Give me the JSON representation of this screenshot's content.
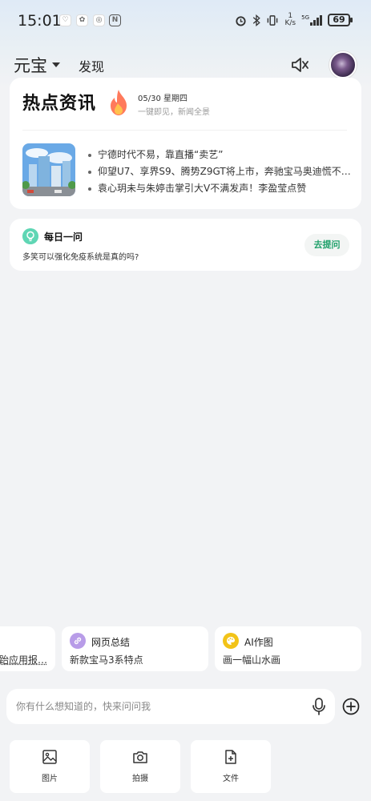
{
  "status_bar": {
    "time": "15:01",
    "net_speed_value": "1",
    "net_speed_unit": "K/s",
    "network_type": "5G",
    "battery": "69"
  },
  "header": {
    "brand": "元宝",
    "discover": "发现"
  },
  "news_card": {
    "title": "热点资讯",
    "date": "05/30 星期四",
    "subtitle": "一键即见，新闻全景",
    "items": [
      "宁德时代不易，靠直播“卖艺”",
      "仰望U7、享界S9、腾势Z9GT将上市，奔驰宝马奥迪慌不…",
      "袁心玥未与朱婷击掌引大V不满发声！李盈莹点赞"
    ]
  },
  "daily": {
    "title": "每日一问",
    "question": "多笑可以强化免疫系统是真的吗?",
    "button": "去提问"
  },
  "suggestions": [
    {
      "title": "",
      "desc": "跆应用报…",
      "icon": "app-icon"
    },
    {
      "title": "网页总结",
      "desc": "新款宝马3系特点",
      "icon": "link-icon",
      "color": "#b89ce8"
    },
    {
      "title": "AI作图",
      "desc": "画一幅山水画",
      "icon": "palette-icon",
      "color": "#f2c318"
    }
  ],
  "input": {
    "placeholder": "你有什么想知道的，快来问问我"
  },
  "tools": [
    {
      "label": "图片",
      "icon": "image-icon"
    },
    {
      "label": "拍摄",
      "icon": "camera-icon"
    },
    {
      "label": "文件",
      "icon": "file-icon"
    }
  ],
  "colors": {
    "accent_green": "#1fa06a",
    "daily_icon": "#5fd6b4"
  }
}
